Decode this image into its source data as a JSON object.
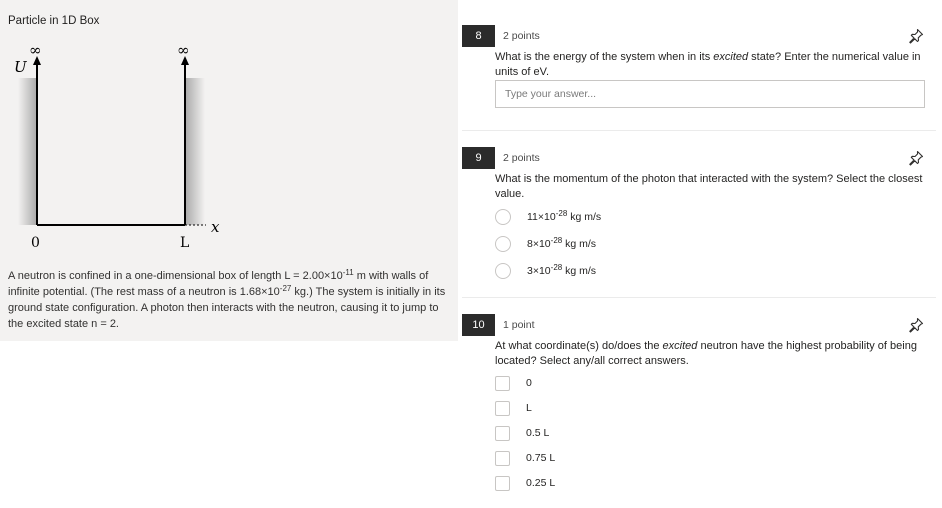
{
  "left": {
    "title": "Particle in 1D Box",
    "diagram": {
      "potential_label": "U",
      "infinity_symbol": "∞",
      "x_axis_label": "x",
      "left_wall_label": "0",
      "right_wall_label": "L"
    },
    "description": {
      "part1": "A neutron is confined in a one-dimensional box of length L = 2.00×10",
      "exp1": "-11",
      "part2": " m with walls of infinite potential. (The rest mass of a neutron is 1.68×10",
      "exp2": "-27",
      "part3": " kg.) The system is initially in its ground state configuration. A photon then interacts with the neutron, causing it to jump to the excited state n = 2."
    }
  },
  "questions": [
    {
      "number": "8",
      "points": "2 points",
      "text_before": "What is the energy of the system when in its ",
      "text_em": "excited",
      "text_after": " state? Enter the numerical value in units of eV.",
      "input_placeholder": "Type your answer..."
    },
    {
      "number": "9",
      "points": "2 points",
      "text": "What is the momentum of the photon that interacted with the system? Select the closest value.",
      "options": [
        {
          "base": "11×10",
          "exp": "-28",
          "unit": " kg m/s"
        },
        {
          "base": "8×10",
          "exp": "-28",
          "unit": " kg m/s"
        },
        {
          "base": "3×10",
          "exp": "-28",
          "unit": " kg m/s"
        }
      ]
    },
    {
      "number": "10",
      "points": "1 point",
      "text_before": "At what coordinate(s) do/does the ",
      "text_em": "excited",
      "text_after": " neutron have the highest probability of being located? Select any/all correct answers.",
      "options": [
        "0",
        "L",
        "0.5 L",
        "0.75 L",
        "0.25 L"
      ]
    }
  ],
  "icons": {
    "pin": "pin-icon"
  }
}
